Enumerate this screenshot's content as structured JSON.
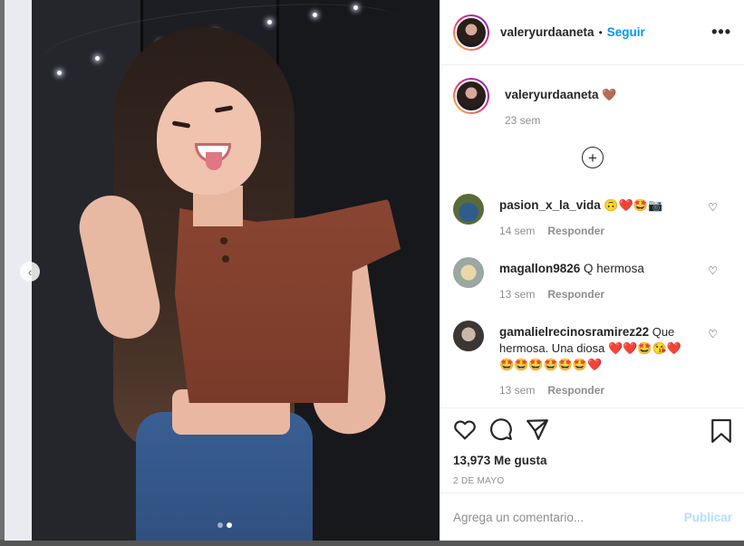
{
  "post": {
    "username": "valeryurdaaneta",
    "follow_label": "Seguir",
    "separator": "•",
    "more_label": "•••",
    "caption_emoji": "🤎",
    "caption_time": "23 sem",
    "likes": "13,973 Me gusta",
    "date": "2 DE MAYO",
    "comment_placeholder": "Agrega un comentario...",
    "publish_label": "Publicar",
    "carousel_prev": "‹"
  },
  "comments": [
    {
      "user": "pasion_x_la_vida",
      "text": " 🙃❤️🤩📷",
      "time": "14 sem",
      "reply": "Responder"
    },
    {
      "user": "magallon9826",
      "text": " Q hermosa",
      "time": "13 sem",
      "reply": "Responder"
    },
    {
      "user": "gamalielrecinosramirez22",
      "text": " Que hermosa. Una diosa ❤️❤️🤩😘❤️🤩🤩🤩🤩🤩🤩❤️",
      "time": "13 sem",
      "reply": "Responder"
    }
  ],
  "load_more": "+",
  "colors": {
    "accent": "#0095f6",
    "muted": "#8e8e8e",
    "text": "#262626"
  },
  "icons": [
    "heart-icon",
    "comment-icon",
    "share-icon",
    "bookmark-icon",
    "plus-circle-icon",
    "more-icon"
  ]
}
